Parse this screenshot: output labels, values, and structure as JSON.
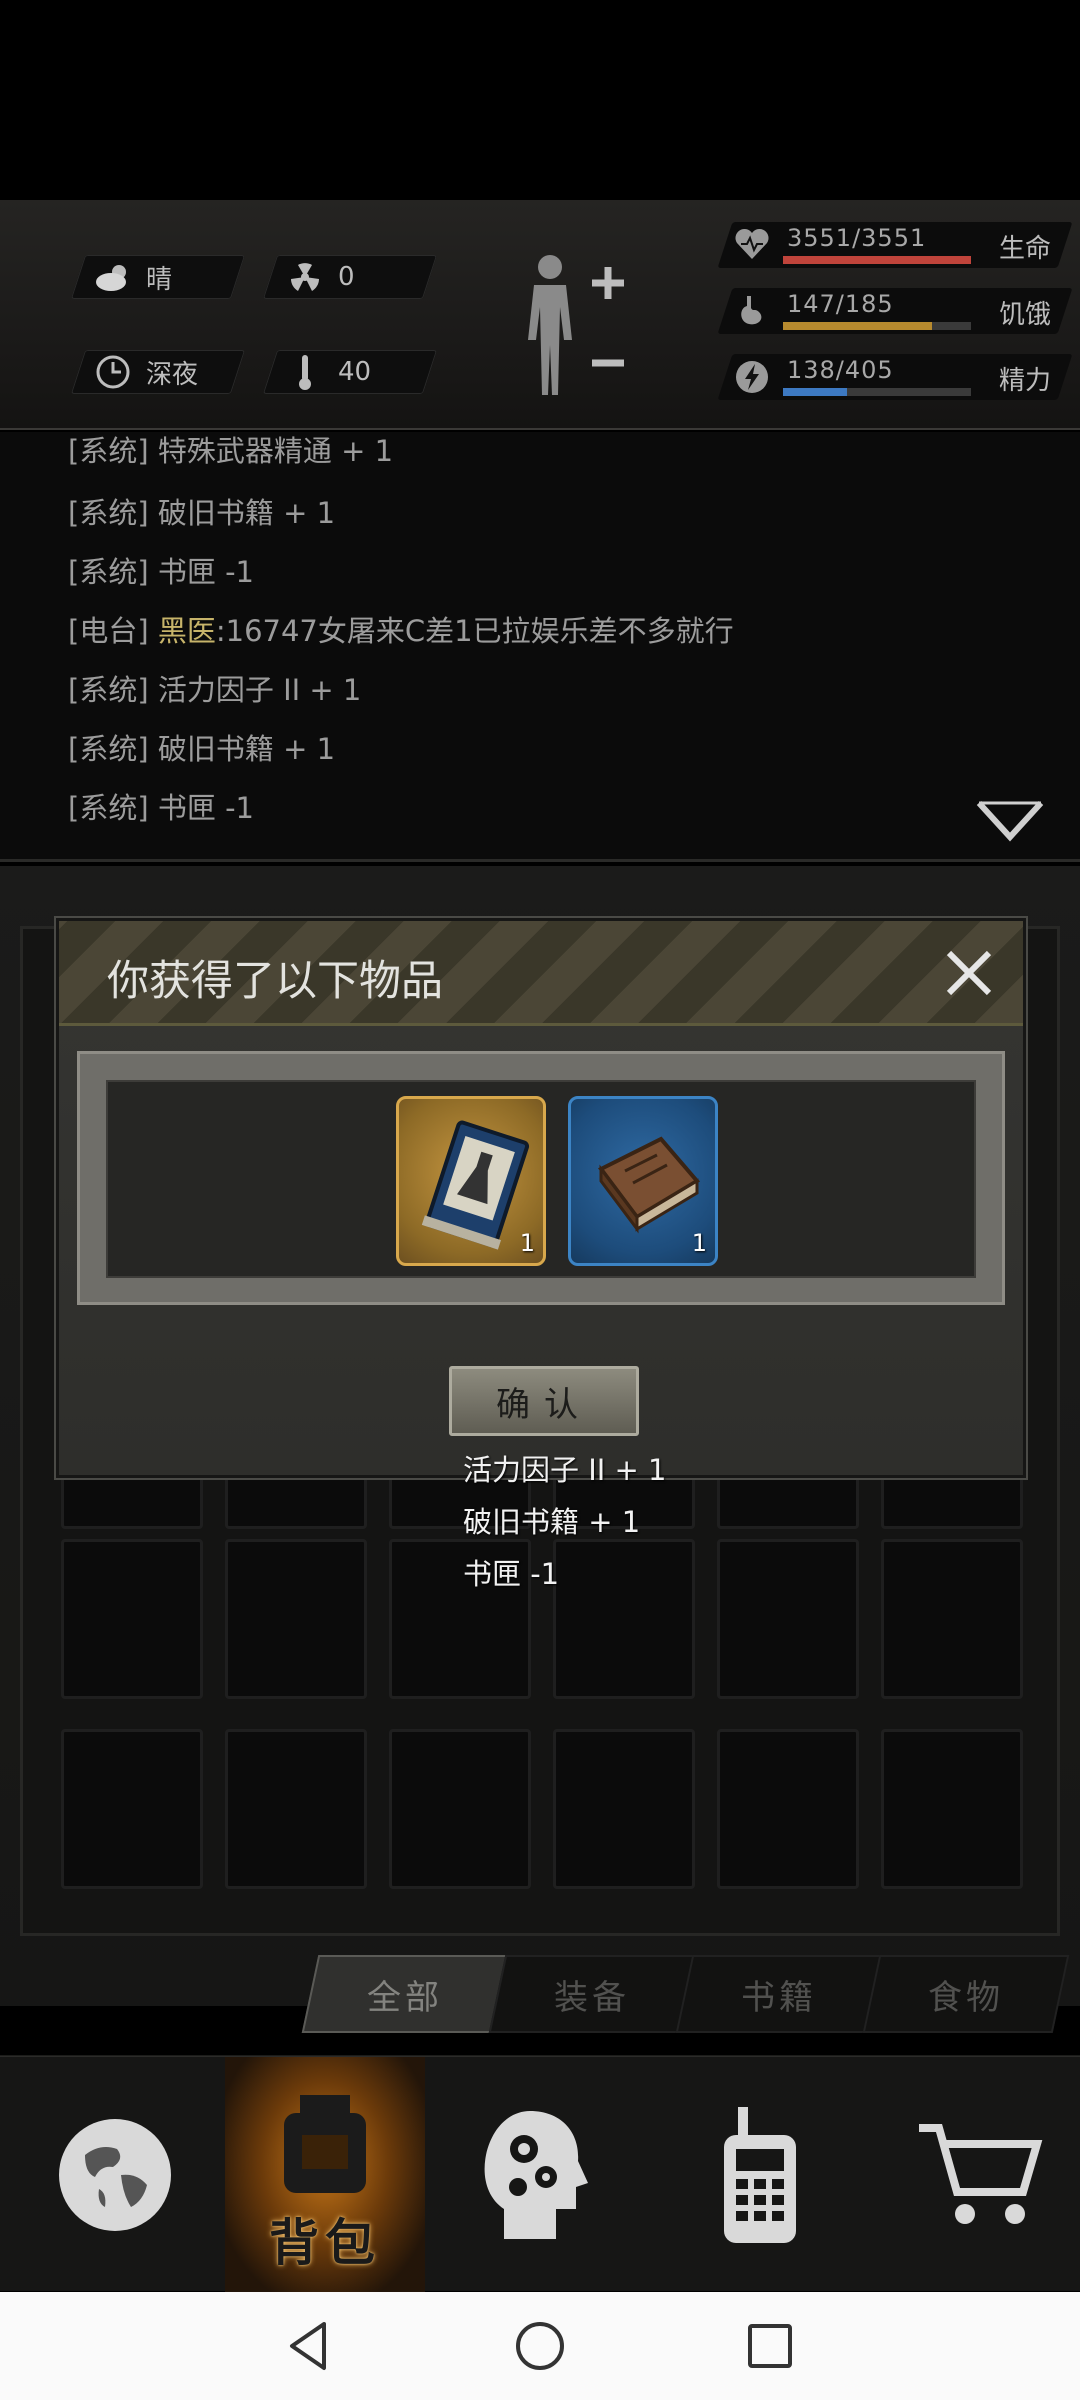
{
  "status": {
    "weather": {
      "label": "晴",
      "icon": "cloud-sun-icon"
    },
    "radiation": {
      "label": "0",
      "icon": "radiation-icon"
    },
    "time": {
      "label": "深夜",
      "icon": "clock-icon"
    },
    "temperature": {
      "label": "40",
      "icon": "thermometer-icon"
    },
    "health": {
      "value": "3551/3551",
      "label": "生命",
      "fraction": 1.0,
      "color": "#c0443b"
    },
    "hunger": {
      "value": "147/185",
      "label": "饥饿",
      "fraction": 0.79,
      "color": "#b78a2e"
    },
    "energy": {
      "value": "138/405",
      "label": "精力",
      "fraction": 0.34,
      "color": "#3d79c2"
    }
  },
  "log": [
    {
      "tag": "[系统]",
      "name": "",
      "text": " 特殊武器精通 + 1"
    },
    {
      "tag": "[系统]",
      "name": "",
      "text": " 破旧书籍 + 1"
    },
    {
      "tag": "[系统]",
      "name": "",
      "text": " 书匣 -1"
    },
    {
      "tag": "[电台]",
      "name": " 黑医",
      "text": ":16747女屠来C差1已拉娱乐差不多就行"
    },
    {
      "tag": "[系统]",
      "name": "",
      "text": " 活力因子 II + 1"
    },
    {
      "tag": "[系统]",
      "name": "",
      "text": " 破旧书籍 + 1"
    },
    {
      "tag": "[系统]",
      "name": "",
      "text": " 书匣 -1"
    }
  ],
  "modal": {
    "title": "你获得了以下物品",
    "items": [
      {
        "icon": "potion-book-icon",
        "count": "1",
        "rarity": "gold"
      },
      {
        "icon": "old-book-icon",
        "count": "1",
        "rarity": "blue"
      }
    ],
    "confirm_label": "确认"
  },
  "toasts": [
    "活力因子 II + 1",
    "破旧书籍 + 1",
    "书匣 -1"
  ],
  "tabs": [
    {
      "label": "全部",
      "active": true
    },
    {
      "label": "装备",
      "active": false
    },
    {
      "label": "书籍",
      "active": false
    },
    {
      "label": "食物",
      "active": false
    }
  ],
  "nav": {
    "world": {
      "icon": "globe-icon"
    },
    "backpack": {
      "icon": "backpack-icon",
      "label": "背包"
    },
    "skills": {
      "icon": "head-gears-icon"
    },
    "radio": {
      "icon": "walkie-talkie-icon"
    },
    "shop": {
      "icon": "cart-icon"
    }
  }
}
